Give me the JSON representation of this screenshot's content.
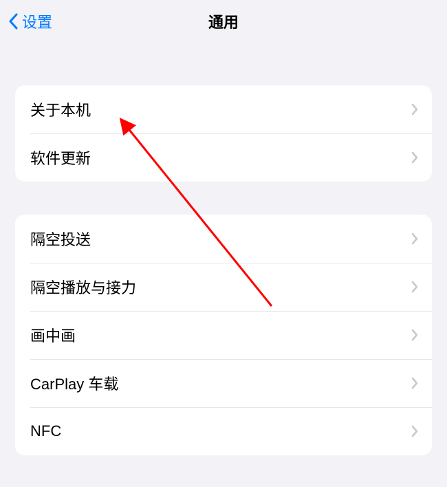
{
  "nav": {
    "back_label": "设置",
    "title": "通用"
  },
  "groups": [
    {
      "rows": [
        {
          "label": "关于本机"
        },
        {
          "label": "软件更新"
        }
      ]
    },
    {
      "rows": [
        {
          "label": "隔空投送"
        },
        {
          "label": "隔空播放与接力"
        },
        {
          "label": "画中画"
        },
        {
          "label": "CarPlay 车载"
        },
        {
          "label": "NFC"
        }
      ]
    }
  ],
  "colors": {
    "accent": "#007aff",
    "bg": "#f2f2f7",
    "annotation": "#ff0000"
  }
}
